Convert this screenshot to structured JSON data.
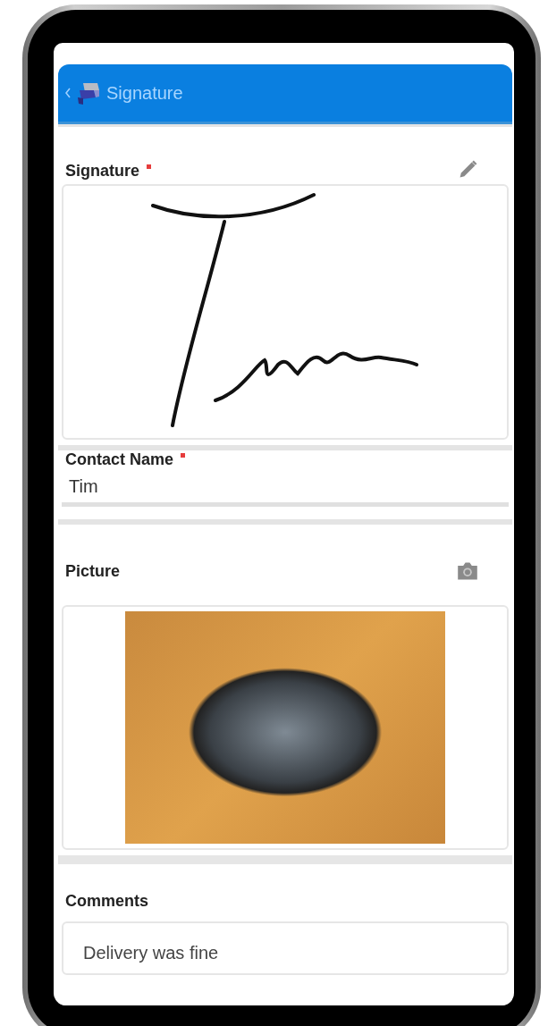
{
  "header": {
    "title": "Signature"
  },
  "fields": [
    {
      "kind": "signature",
      "label": "Signature",
      "required": true
    },
    {
      "kind": "text",
      "label": "Contact Name",
      "required": true,
      "value": "Tim"
    },
    {
      "kind": "picture",
      "label": "Picture",
      "required": false
    },
    {
      "kind": "textarea",
      "label": "Comments",
      "required": false,
      "value": "Delivery was fine"
    }
  ]
}
